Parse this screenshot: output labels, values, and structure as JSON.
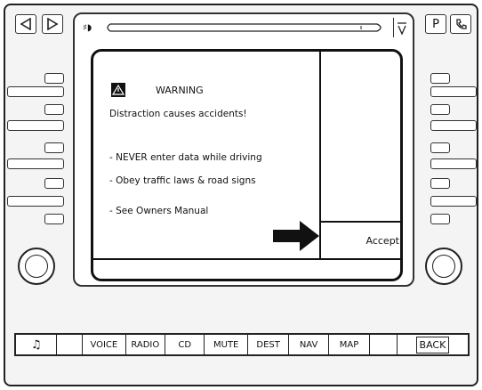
{
  "warning_screen": {
    "title": "WARNING",
    "subtitle": "Distraction causes accidents!",
    "bullets": [
      "- NEVER enter data while driving",
      "- Obey traffic laws & road signs",
      "- See Owners Manual"
    ],
    "accept_label": "Accept"
  },
  "top_bar": {
    "icons": [
      "left-arrow-icon",
      "right-arrow-icon",
      "audio-source-icon",
      "down-arrow-icon",
      "p-icon",
      "phone-icon"
    ]
  },
  "bottom_bar": {
    "buttons": [
      "♫",
      "VOICE",
      "RADIO",
      "CD",
      "MUTE",
      "DEST",
      "NAV",
      "MAP",
      "BACK"
    ]
  }
}
